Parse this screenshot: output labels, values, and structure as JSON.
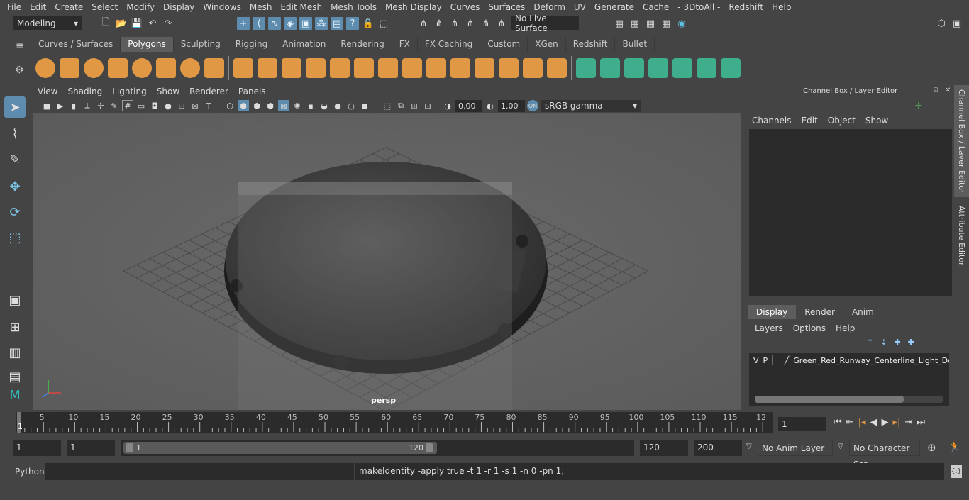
{
  "menubar": [
    "File",
    "Edit",
    "Create",
    "Select",
    "Modify",
    "Display",
    "Windows",
    "Mesh",
    "Edit Mesh",
    "Mesh Tools",
    "Mesh Display",
    "Curves",
    "Surfaces",
    "Deform",
    "UV",
    "Generate",
    "Cache",
    "- 3DtoAll -",
    "Redshift",
    "Help"
  ],
  "status": {
    "workspace": "Modeling",
    "live_surface": "No Live Surface"
  },
  "shelf_tabs": [
    "Curves / Surfaces",
    "Polygons",
    "Sculpting",
    "Rigging",
    "Animation",
    "Rendering",
    "FX",
    "FX Caching",
    "Custom",
    "XGen",
    "Redshift",
    "Bullet"
  ],
  "shelf_active": "Polygons",
  "viewport": {
    "menu": [
      "View",
      "Shading",
      "Lighting",
      "Show",
      "Renderer",
      "Panels"
    ],
    "exposure": "0.00",
    "gamma": "1.00",
    "color_space": "sRGB gamma",
    "camera_label": "persp"
  },
  "channel_box": {
    "title": "Channel Box / Layer Editor",
    "menu": [
      "Channels",
      "Edit",
      "Object",
      "Show"
    ],
    "layer_tabs": [
      "Display",
      "Render",
      "Anim"
    ],
    "layer_active": "Display",
    "layer_menu": [
      "Layers",
      "Options",
      "Help"
    ],
    "layer": {
      "v": "V",
      "p": "P",
      "name": "Green_Red_Runway_Centerline_Light_Dou"
    }
  },
  "side_tabs": [
    "Channel Box / Layer Editor",
    "Attribute Editor"
  ],
  "timeline": {
    "ticks": [
      "5",
      "10",
      "15",
      "20",
      "25",
      "30",
      "35",
      "40",
      "45",
      "50",
      "55",
      "60",
      "65",
      "70",
      "75",
      "80",
      "85",
      "90",
      "95",
      "100",
      "105",
      "110",
      "115",
      "12"
    ],
    "current_frame_marker": "1",
    "current_frame": "1"
  },
  "range": {
    "start": "1",
    "playback_start": "1",
    "slider_start": "1",
    "slider_end": "120",
    "playback_end": "120",
    "end": "200",
    "anim_layer": "No Anim Layer",
    "character_set": "No Character Set"
  },
  "command": {
    "language": "Python",
    "output": "makeIdentity -apply true -t 1 -r 1 -s 1 -n 0 -pn 1;"
  },
  "colors": {
    "accent": "#5d8cae",
    "shelf_orange": "#e09845",
    "shelf_green": "#3fae8c",
    "active_tab": "#5d5d5d"
  }
}
